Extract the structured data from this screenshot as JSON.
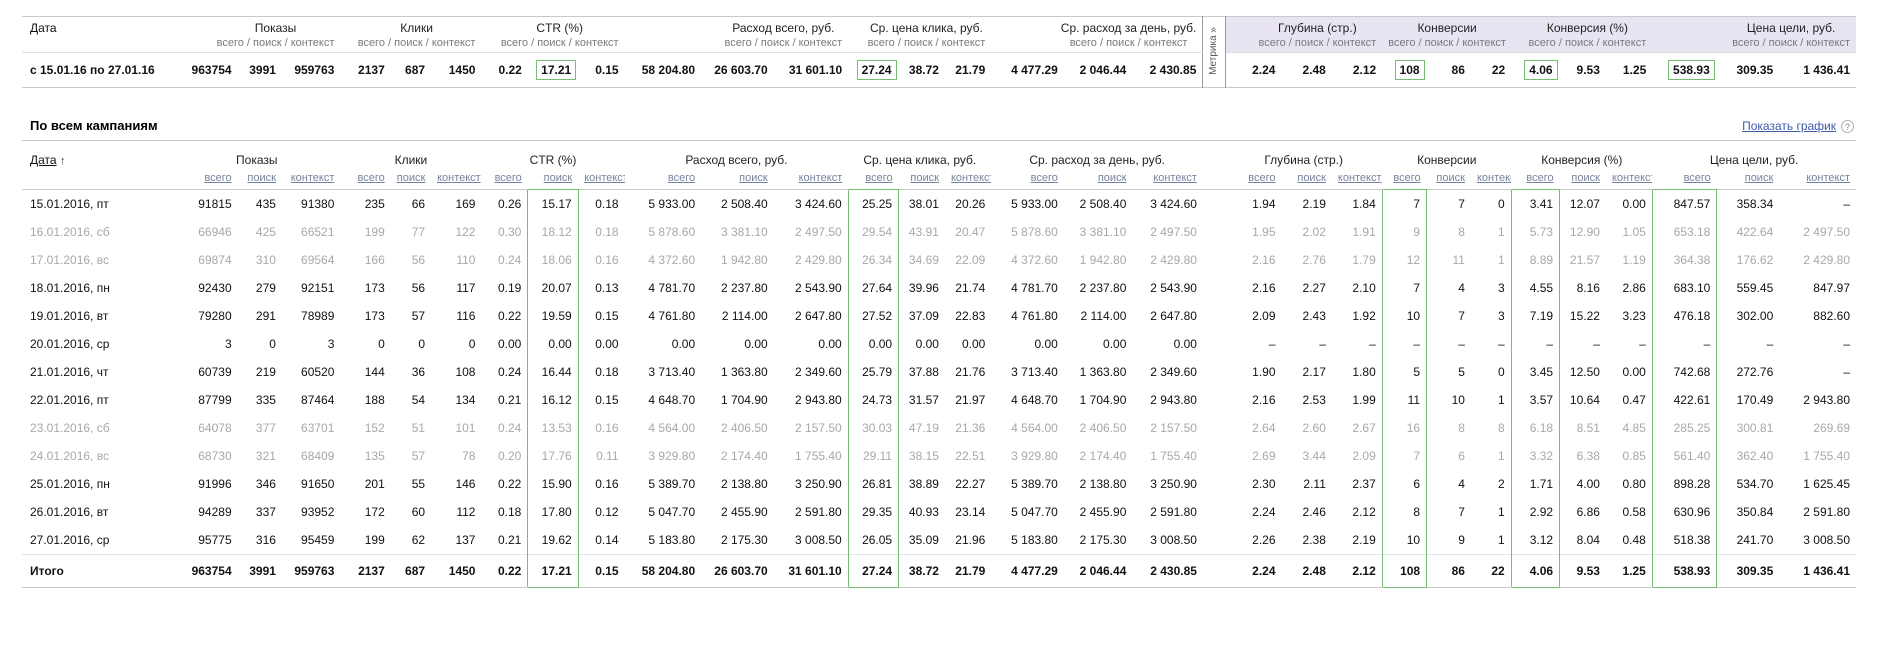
{
  "colors": {
    "highlight_border": "#79bd72",
    "metrica_header_bg": "#e9e4f1",
    "link_blue": "#3d5ca6",
    "muted_row_text": "#a8a8a8",
    "table_line": "#c9c9c9"
  },
  "sub_columns": [
    "всего",
    "поиск",
    "контекст"
  ],
  "sub_columns_joined": "всего / поиск / контекст",
  "metrica_tab": "Метрика »",
  "groups": [
    {
      "key": "impressions",
      "label": "Показы",
      "metrica": false
    },
    {
      "key": "clicks",
      "label": "Клики",
      "metrica": false
    },
    {
      "key": "ctr",
      "label": "CTR (%)",
      "metrica": false
    },
    {
      "key": "cost",
      "label": "Расход всего, руб.",
      "metrica": false
    },
    {
      "key": "cpc",
      "label": "Ср. цена клика, руб.",
      "metrica": false
    },
    {
      "key": "daily_cost",
      "label": "Ср. расход за день, руб.",
      "metrica": false
    },
    {
      "key": "depth",
      "label": "Глубина (стр.)",
      "metrica": true
    },
    {
      "key": "conversions",
      "label": "Конверсии",
      "metrica": true
    },
    {
      "key": "conv_rate",
      "label": "Конверсия (%)",
      "metrica": true
    },
    {
      "key": "goal_cost",
      "label": "Цена цели, руб.",
      "metrica": true
    }
  ],
  "highlights": [
    [
      "ctr",
      1
    ],
    [
      "cpc",
      0
    ],
    [
      "conversions",
      0
    ],
    [
      "conv_rate",
      0
    ],
    [
      "goal_cost",
      0
    ]
  ],
  "summary": {
    "date_header": "Дата",
    "period": "с 15.01.16 по 27.01.16",
    "values": {
      "impressions": [
        "963754",
        "3991",
        "959763"
      ],
      "clicks": [
        "2137",
        "687",
        "1450"
      ],
      "ctr": [
        "0.22",
        "17.21",
        "0.15"
      ],
      "cost": [
        "58 204.80",
        "26 603.70",
        "31 601.10"
      ],
      "cpc": [
        "27.24",
        "38.72",
        "21.79"
      ],
      "daily_cost": [
        "4 477.29",
        "2 046.44",
        "2 430.85"
      ],
      "depth": [
        "2.24",
        "2.48",
        "2.12"
      ],
      "conversions": [
        "108",
        "86",
        "22"
      ],
      "conv_rate": [
        "4.06",
        "9.53",
        "1.25"
      ],
      "goal_cost": [
        "538.93",
        "309.35",
        "1 436.41"
      ]
    }
  },
  "section": {
    "title": "По всем кампаниям",
    "chart_link": "Показать график",
    "help_icon": "?"
  },
  "detail": {
    "date_header": "Дата",
    "sort_arrow": "↑",
    "total_label": "Итого",
    "rows": [
      {
        "date": "15.01.2016, пт",
        "weekend": false,
        "values": {
          "impressions": [
            "91815",
            "435",
            "91380"
          ],
          "clicks": [
            "235",
            "66",
            "169"
          ],
          "ctr": [
            "0.26",
            "15.17",
            "0.18"
          ],
          "cost": [
            "5 933.00",
            "2 508.40",
            "3 424.60"
          ],
          "cpc": [
            "25.25",
            "38.01",
            "20.26"
          ],
          "daily_cost": [
            "5 933.00",
            "2 508.40",
            "3 424.60"
          ],
          "depth": [
            "1.94",
            "2.19",
            "1.84"
          ],
          "conversions": [
            "7",
            "7",
            "0"
          ],
          "conv_rate": [
            "3.41",
            "12.07",
            "0.00"
          ],
          "goal_cost": [
            "847.57",
            "358.34",
            "–"
          ]
        }
      },
      {
        "date": "16.01.2016, сб",
        "weekend": true,
        "values": {
          "impressions": [
            "66946",
            "425",
            "66521"
          ],
          "clicks": [
            "199",
            "77",
            "122"
          ],
          "ctr": [
            "0.30",
            "18.12",
            "0.18"
          ],
          "cost": [
            "5 878.60",
            "3 381.10",
            "2 497.50"
          ],
          "cpc": [
            "29.54",
            "43.91",
            "20.47"
          ],
          "daily_cost": [
            "5 878.60",
            "3 381.10",
            "2 497.50"
          ],
          "depth": [
            "1.95",
            "2.02",
            "1.91"
          ],
          "conversions": [
            "9",
            "8",
            "1"
          ],
          "conv_rate": [
            "5.73",
            "12.90",
            "1.05"
          ],
          "goal_cost": [
            "653.18",
            "422.64",
            "2 497.50"
          ]
        }
      },
      {
        "date": "17.01.2016, вс",
        "weekend": true,
        "values": {
          "impressions": [
            "69874",
            "310",
            "69564"
          ],
          "clicks": [
            "166",
            "56",
            "110"
          ],
          "ctr": [
            "0.24",
            "18.06",
            "0.16"
          ],
          "cost": [
            "4 372.60",
            "1 942.80",
            "2 429.80"
          ],
          "cpc": [
            "26.34",
            "34.69",
            "22.09"
          ],
          "daily_cost": [
            "4 372.60",
            "1 942.80",
            "2 429.80"
          ],
          "depth": [
            "2.16",
            "2.76",
            "1.79"
          ],
          "conversions": [
            "12",
            "11",
            "1"
          ],
          "conv_rate": [
            "8.89",
            "21.57",
            "1.19"
          ],
          "goal_cost": [
            "364.38",
            "176.62",
            "2 429.80"
          ]
        }
      },
      {
        "date": "18.01.2016, пн",
        "weekend": false,
        "values": {
          "impressions": [
            "92430",
            "279",
            "92151"
          ],
          "clicks": [
            "173",
            "56",
            "117"
          ],
          "ctr": [
            "0.19",
            "20.07",
            "0.13"
          ],
          "cost": [
            "4 781.70",
            "2 237.80",
            "2 543.90"
          ],
          "cpc": [
            "27.64",
            "39.96",
            "21.74"
          ],
          "daily_cost": [
            "4 781.70",
            "2 237.80",
            "2 543.90"
          ],
          "depth": [
            "2.16",
            "2.27",
            "2.10"
          ],
          "conversions": [
            "7",
            "4",
            "3"
          ],
          "conv_rate": [
            "4.55",
            "8.16",
            "2.86"
          ],
          "goal_cost": [
            "683.10",
            "559.45",
            "847.97"
          ]
        }
      },
      {
        "date": "19.01.2016, вт",
        "weekend": false,
        "values": {
          "impressions": [
            "79280",
            "291",
            "78989"
          ],
          "clicks": [
            "173",
            "57",
            "116"
          ],
          "ctr": [
            "0.22",
            "19.59",
            "0.15"
          ],
          "cost": [
            "4 761.80",
            "2 114.00",
            "2 647.80"
          ],
          "cpc": [
            "27.52",
            "37.09",
            "22.83"
          ],
          "daily_cost": [
            "4 761.80",
            "2 114.00",
            "2 647.80"
          ],
          "depth": [
            "2.09",
            "2.43",
            "1.92"
          ],
          "conversions": [
            "10",
            "7",
            "3"
          ],
          "conv_rate": [
            "7.19",
            "15.22",
            "3.23"
          ],
          "goal_cost": [
            "476.18",
            "302.00",
            "882.60"
          ]
        }
      },
      {
        "date": "20.01.2016, ср",
        "weekend": false,
        "values": {
          "impressions": [
            "3",
            "0",
            "3"
          ],
          "clicks": [
            "0",
            "0",
            "0"
          ],
          "ctr": [
            "0.00",
            "0.00",
            "0.00"
          ],
          "cost": [
            "0.00",
            "0.00",
            "0.00"
          ],
          "cpc": [
            "0.00",
            "0.00",
            "0.00"
          ],
          "daily_cost": [
            "0.00",
            "0.00",
            "0.00"
          ],
          "depth": [
            "–",
            "–",
            "–"
          ],
          "conversions": [
            "–",
            "–",
            "–"
          ],
          "conv_rate": [
            "–",
            "–",
            "–"
          ],
          "goal_cost": [
            "–",
            "–",
            "–"
          ]
        }
      },
      {
        "date": "21.01.2016, чт",
        "weekend": false,
        "values": {
          "impressions": [
            "60739",
            "219",
            "60520"
          ],
          "clicks": [
            "144",
            "36",
            "108"
          ],
          "ctr": [
            "0.24",
            "16.44",
            "0.18"
          ],
          "cost": [
            "3 713.40",
            "1 363.80",
            "2 349.60"
          ],
          "cpc": [
            "25.79",
            "37.88",
            "21.76"
          ],
          "daily_cost": [
            "3 713.40",
            "1 363.80",
            "2 349.60"
          ],
          "depth": [
            "1.90",
            "2.17",
            "1.80"
          ],
          "conversions": [
            "5",
            "5",
            "0"
          ],
          "conv_rate": [
            "3.45",
            "12.50",
            "0.00"
          ],
          "goal_cost": [
            "742.68",
            "272.76",
            "–"
          ]
        }
      },
      {
        "date": "22.01.2016, пт",
        "weekend": false,
        "values": {
          "impressions": [
            "87799",
            "335",
            "87464"
          ],
          "clicks": [
            "188",
            "54",
            "134"
          ],
          "ctr": [
            "0.21",
            "16.12",
            "0.15"
          ],
          "cost": [
            "4 648.70",
            "1 704.90",
            "2 943.80"
          ],
          "cpc": [
            "24.73",
            "31.57",
            "21.97"
          ],
          "daily_cost": [
            "4 648.70",
            "1 704.90",
            "2 943.80"
          ],
          "depth": [
            "2.16",
            "2.53",
            "1.99"
          ],
          "conversions": [
            "11",
            "10",
            "1"
          ],
          "conv_rate": [
            "3.57",
            "10.64",
            "0.47"
          ],
          "goal_cost": [
            "422.61",
            "170.49",
            "2 943.80"
          ]
        }
      },
      {
        "date": "23.01.2016, сб",
        "weekend": true,
        "values": {
          "impressions": [
            "64078",
            "377",
            "63701"
          ],
          "clicks": [
            "152",
            "51",
            "101"
          ],
          "ctr": [
            "0.24",
            "13.53",
            "0.16"
          ],
          "cost": [
            "4 564.00",
            "2 406.50",
            "2 157.50"
          ],
          "cpc": [
            "30.03",
            "47.19",
            "21.36"
          ],
          "daily_cost": [
            "4 564.00",
            "2 406.50",
            "2 157.50"
          ],
          "depth": [
            "2.64",
            "2.60",
            "2.67"
          ],
          "conversions": [
            "16",
            "8",
            "8"
          ],
          "conv_rate": [
            "6.18",
            "8.51",
            "4.85"
          ],
          "goal_cost": [
            "285.25",
            "300.81",
            "269.69"
          ]
        }
      },
      {
        "date": "24.01.2016, вс",
        "weekend": true,
        "values": {
          "impressions": [
            "68730",
            "321",
            "68409"
          ],
          "clicks": [
            "135",
            "57",
            "78"
          ],
          "ctr": [
            "0.20",
            "17.76",
            "0.11"
          ],
          "cost": [
            "3 929.80",
            "2 174.40",
            "1 755.40"
          ],
          "cpc": [
            "29.11",
            "38.15",
            "22.51"
          ],
          "daily_cost": [
            "3 929.80",
            "2 174.40",
            "1 755.40"
          ],
          "depth": [
            "2.69",
            "3.44",
            "2.09"
          ],
          "conversions": [
            "7",
            "6",
            "1"
          ],
          "conv_rate": [
            "3.32",
            "6.38",
            "0.85"
          ],
          "goal_cost": [
            "561.40",
            "362.40",
            "1 755.40"
          ]
        }
      },
      {
        "date": "25.01.2016, пн",
        "weekend": false,
        "values": {
          "impressions": [
            "91996",
            "346",
            "91650"
          ],
          "clicks": [
            "201",
            "55",
            "146"
          ],
          "ctr": [
            "0.22",
            "15.90",
            "0.16"
          ],
          "cost": [
            "5 389.70",
            "2 138.80",
            "3 250.90"
          ],
          "cpc": [
            "26.81",
            "38.89",
            "22.27"
          ],
          "daily_cost": [
            "5 389.70",
            "2 138.80",
            "3 250.90"
          ],
          "depth": [
            "2.30",
            "2.11",
            "2.37"
          ],
          "conversions": [
            "6",
            "4",
            "2"
          ],
          "conv_rate": [
            "1.71",
            "4.00",
            "0.80"
          ],
          "goal_cost": [
            "898.28",
            "534.70",
            "1 625.45"
          ]
        }
      },
      {
        "date": "26.01.2016, вт",
        "weekend": false,
        "values": {
          "impressions": [
            "94289",
            "337",
            "93952"
          ],
          "clicks": [
            "172",
            "60",
            "112"
          ],
          "ctr": [
            "0.18",
            "17.80",
            "0.12"
          ],
          "cost": [
            "5 047.70",
            "2 455.90",
            "2 591.80"
          ],
          "cpc": [
            "29.35",
            "40.93",
            "23.14"
          ],
          "daily_cost": [
            "5 047.70",
            "2 455.90",
            "2 591.80"
          ],
          "depth": [
            "2.24",
            "2.46",
            "2.12"
          ],
          "conversions": [
            "8",
            "7",
            "1"
          ],
          "conv_rate": [
            "2.92",
            "6.86",
            "0.58"
          ],
          "goal_cost": [
            "630.96",
            "350.84",
            "2 591.80"
          ]
        }
      },
      {
        "date": "27.01.2016, ср",
        "weekend": false,
        "values": {
          "impressions": [
            "95775",
            "316",
            "95459"
          ],
          "clicks": [
            "199",
            "62",
            "137"
          ],
          "ctr": [
            "0.21",
            "19.62",
            "0.14"
          ],
          "cost": [
            "5 183.80",
            "2 175.30",
            "3 008.50"
          ],
          "cpc": [
            "26.05",
            "35.09",
            "21.96"
          ],
          "daily_cost": [
            "5 183.80",
            "2 175.30",
            "3 008.50"
          ],
          "depth": [
            "2.26",
            "2.38",
            "2.19"
          ],
          "conversions": [
            "10",
            "9",
            "1"
          ],
          "conv_rate": [
            "3.12",
            "8.04",
            "0.48"
          ],
          "goal_cost": [
            "518.38",
            "241.70",
            "3 008.50"
          ]
        }
      }
    ],
    "total": {
      "impressions": [
        "963754",
        "3991",
        "959763"
      ],
      "clicks": [
        "2137",
        "687",
        "1450"
      ],
      "ctr": [
        "0.22",
        "17.21",
        "0.15"
      ],
      "cost": [
        "58 204.80",
        "26 603.70",
        "31 601.10"
      ],
      "cpc": [
        "27.24",
        "38.72",
        "21.79"
      ],
      "daily_cost": [
        "4 477.29",
        "2 046.44",
        "2 430.85"
      ],
      "depth": [
        "2.24",
        "2.48",
        "2.12"
      ],
      "conversions": [
        "108",
        "86",
        "22"
      ],
      "conv_rate": [
        "4.06",
        "9.53",
        "1.25"
      ],
      "goal_cost": [
        "538.93",
        "309.35",
        "1 436.41"
      ]
    }
  }
}
